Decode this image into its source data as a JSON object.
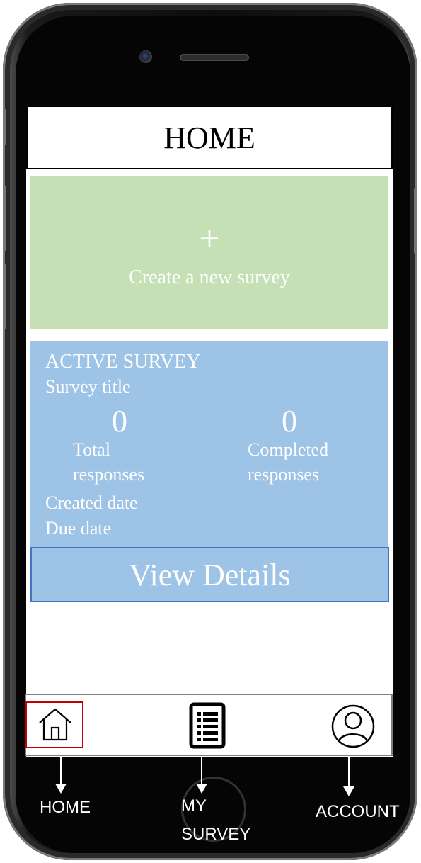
{
  "header": {
    "title": "HOME"
  },
  "create_card": {
    "icon": "plus-icon",
    "plus_glyph": "+",
    "label": "Create a new survey"
  },
  "active_survey": {
    "heading": "ACTIVE SURVEY",
    "survey_title": "Survey title",
    "total_count": "0",
    "total_label_line1": "Total",
    "total_label_line2": "responses",
    "completed_count": "0",
    "completed_label_line1": "Completed",
    "completed_label_line2": "responses",
    "created_date_label": "Created date",
    "due_date_label": "Due date",
    "view_details_label": "View Details"
  },
  "tabbar": {
    "items": [
      {
        "icon": "home-icon",
        "selected": true
      },
      {
        "icon": "survey-list-icon",
        "selected": false
      },
      {
        "icon": "account-icon",
        "selected": false
      }
    ]
  },
  "annotations": {
    "home": "HOME",
    "my_survey_line1": "MY",
    "my_survey_line2": "SURVEY",
    "account": "ACCOUNT"
  },
  "colors": {
    "create_card_bg": "#c5e0b4",
    "active_card_bg": "#9dc3e6",
    "view_button_border": "#4472c4",
    "selected_tab_border": "#c00000"
  }
}
